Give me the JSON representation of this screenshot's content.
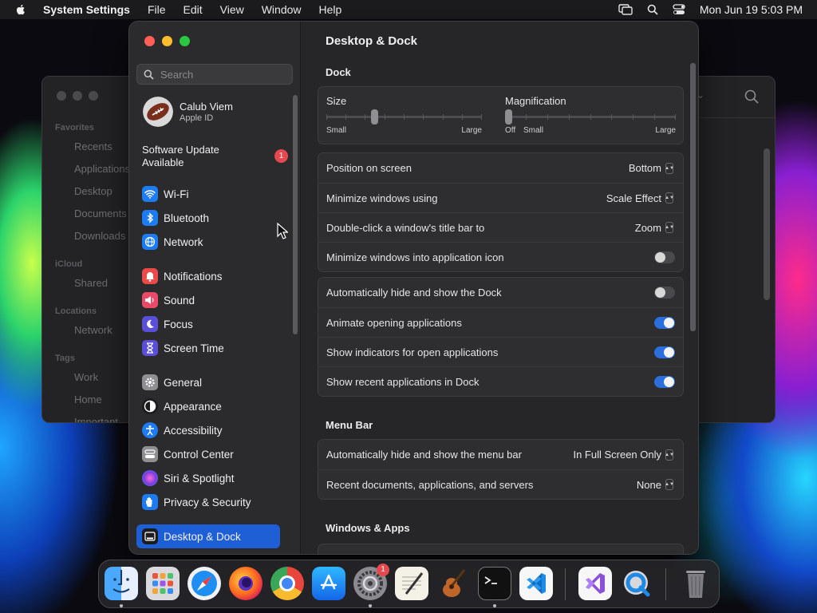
{
  "menubar": {
    "app_name": "System Settings",
    "menus": [
      "File",
      "Edit",
      "View",
      "Window",
      "Help"
    ],
    "datetime": "Mon Jun 19  5:03 PM"
  },
  "finder": {
    "sections": [
      {
        "header": "Favorites",
        "items": [
          "Recents",
          "Applications",
          "Desktop",
          "Documents",
          "Downloads"
        ]
      },
      {
        "header": "iCloud",
        "items": [
          "Shared"
        ]
      },
      {
        "header": "Locations",
        "items": [
          "Network"
        ]
      },
      {
        "header": "Tags",
        "items": [
          "Work",
          "Home",
          "Important"
        ]
      }
    ]
  },
  "sidebar": {
    "search_placeholder": "Search",
    "user_name": "Calub Viem",
    "user_sub": "Apple ID",
    "update_label": "Software Update Available",
    "update_badge": "1",
    "items": [
      {
        "label": "Wi-Fi",
        "icon": "wifi-icon",
        "color": "#1e7cf2"
      },
      {
        "label": "Bluetooth",
        "icon": "bluetooth-icon",
        "color": "#1e7cf2"
      },
      {
        "label": "Network",
        "icon": "globe-icon",
        "color": "#1e7cf2"
      },
      {
        "label": "Notifications",
        "icon": "bell-icon",
        "color": "#ea4a4a"
      },
      {
        "label": "Sound",
        "icon": "speaker-icon",
        "color": "#ea4a6a"
      },
      {
        "label": "Focus",
        "icon": "moon-icon",
        "color": "#5b4fd9"
      },
      {
        "label": "Screen Time",
        "icon": "hourglass-icon",
        "color": "#5b4fd9"
      },
      {
        "label": "General",
        "icon": "gear-icon",
        "color": "#8e8e93"
      },
      {
        "label": "Appearance",
        "icon": "appearance-icon",
        "color": "#1c1c1e"
      },
      {
        "label": "Accessibility",
        "icon": "accessibility-icon",
        "color": "#1e7cf2"
      },
      {
        "label": "Control Center",
        "icon": "control-center-icon",
        "color": "#8e8e93"
      },
      {
        "label": "Siri & Spotlight",
        "icon": "siri-icon",
        "color": "#7a3be0"
      },
      {
        "label": "Privacy & Security",
        "icon": "hand-icon",
        "color": "#1e7cf2"
      },
      {
        "label": "Desktop & Dock",
        "icon": "dock-icon",
        "color": "#1c1c1e"
      }
    ]
  },
  "main": {
    "title": "Desktop & Dock",
    "dock_section": "Dock",
    "size": {
      "label": "Size",
      "min": "Small",
      "max": "Large",
      "value": 0.3
    },
    "magnification": {
      "label": "Magnification",
      "off": "Off",
      "min": "Small",
      "max": "Large",
      "value": 0.0
    },
    "rows_a": [
      {
        "label": "Position on screen",
        "value": "Bottom"
      },
      {
        "label": "Minimize windows using",
        "value": "Scale Effect"
      },
      {
        "label": "Double-click a window's title bar to",
        "value": "Zoom"
      },
      {
        "label": "Minimize windows into application icon",
        "toggle": false
      }
    ],
    "rows_b": [
      {
        "label": "Automatically hide and show the Dock",
        "toggle": false
      },
      {
        "label": "Animate opening applications",
        "toggle": true
      },
      {
        "label": "Show indicators for open applications",
        "toggle": true
      },
      {
        "label": "Show recent applications in Dock",
        "toggle": true
      }
    ],
    "menubar_section": "Menu Bar",
    "rows_c": [
      {
        "label": "Automatically hide and show the menu bar",
        "value": "In Full Screen Only"
      },
      {
        "label": "Recent documents, applications, and servers",
        "value": "None"
      }
    ],
    "windows_section": "Windows & Apps"
  },
  "dock": {
    "settings_badge": "1",
    "apps": [
      "Finder",
      "Launchpad",
      "Safari",
      "Firefox",
      "Chrome",
      "App Store",
      "System Settings",
      "TextEdit",
      "Instruments",
      "Terminal",
      "VS Code",
      "Visual Studio",
      "QuickTime",
      "Trash"
    ]
  }
}
